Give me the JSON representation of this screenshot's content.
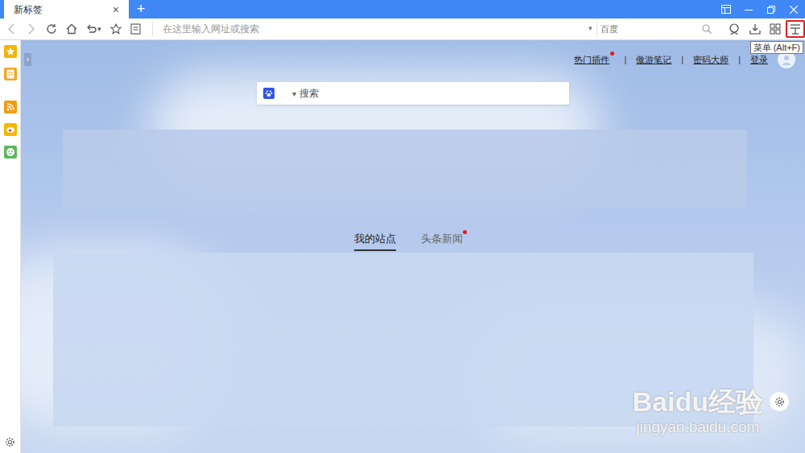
{
  "tabs": [
    {
      "label": "新标签",
      "selected": true,
      "close": "×"
    }
  ],
  "new_tab": "+",
  "toolbar": {
    "undo_dropdown": "▾",
    "address_placeholder": "在这里输入网址或搜索",
    "address_dropdown": "▾",
    "search_engine": "百度"
  },
  "tooltip": "菜单 (Alt+F)",
  "sidebar": {
    "toggle": "›"
  },
  "top_links": [
    {
      "label": "热门插件",
      "badge": true
    },
    {
      "label": "傲游笔记",
      "badge": false
    },
    {
      "label": "密码大师",
      "badge": false
    },
    {
      "label": "登录",
      "badge": false
    }
  ],
  "separator": "|",
  "search": {
    "dropdown": "▾",
    "placeholder": "搜索"
  },
  "content_tabs": [
    {
      "label": "我的站点",
      "selected": true,
      "badge": false
    },
    {
      "label": "头条新闻",
      "selected": false,
      "badge": true
    }
  ],
  "watermark": {
    "brand": "Baidu经验",
    "url": "jingyan.baidu.com"
  }
}
